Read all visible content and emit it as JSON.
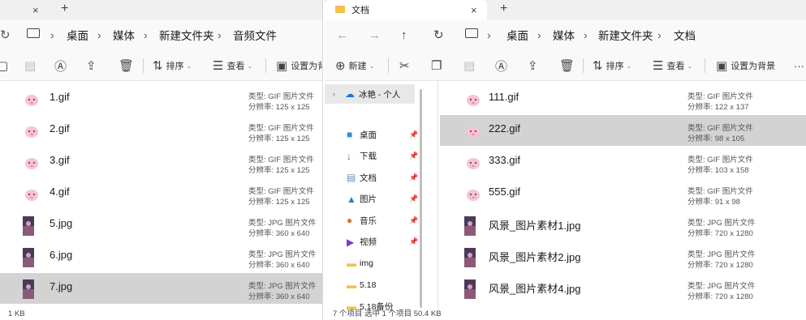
{
  "left_window": {
    "tab_close": "×",
    "new_tab": "+",
    "breadcrumb": [
      "桌面",
      "媒体",
      "新建文件夹",
      "音频文件"
    ],
    "toolbar": {
      "sort": "排序",
      "view": "查看",
      "set_bg": "设置为背"
    },
    "files": [
      {
        "name": "1.gif",
        "type": "类型: GIF 图片文件",
        "res": "分辨率: 125 x 125",
        "kind": "gif"
      },
      {
        "name": "2.gif",
        "type": "类型: GIF 图片文件",
        "res": "分辨率: 125 x 125",
        "kind": "gif"
      },
      {
        "name": "3.gif",
        "type": "类型: GIF 图片文件",
        "res": "分辨率: 125 x 125",
        "kind": "gif"
      },
      {
        "name": "4.gif",
        "type": "类型: GIF 图片文件",
        "res": "分辨率: 125 x 125",
        "kind": "gif"
      },
      {
        "name": "5.jpg",
        "type": "类型: JPG 图片文件",
        "res": "分辨率: 360 x 640",
        "kind": "jpg"
      },
      {
        "name": "6.jpg",
        "type": "类型: JPG 图片文件",
        "res": "分辨率: 360 x 640",
        "kind": "jpg"
      },
      {
        "name": "7.jpg",
        "type": "类型: JPG 图片文件",
        "res": "分辨率: 360 x 640",
        "kind": "jpg",
        "selected": true
      }
    ],
    "status": "1 KB"
  },
  "right_window": {
    "tab_title": "文档",
    "tab_close": "×",
    "new_tab": "+",
    "breadcrumb": [
      "桌面",
      "媒体",
      "新建文件夹",
      "文档"
    ],
    "toolbar": {
      "new": "新建",
      "sort": "排序",
      "view": "查看",
      "set_bg": "设置为背景",
      "more": "···"
    },
    "nav": [
      {
        "label": "冰艳 - 个人",
        "icon": "☁",
        "color": "#1a73e8",
        "pinned": false,
        "top": true
      },
      {
        "label": "桌面",
        "icon": "■",
        "color": "#2b8fd6",
        "pinned": true
      },
      {
        "label": "下载",
        "icon": "↓",
        "color": "#2a6fb5",
        "pinned": true
      },
      {
        "label": "文档",
        "icon": "▤",
        "color": "#6a8fb5",
        "pinned": true
      },
      {
        "label": "图片",
        "icon": "▲",
        "color": "#2f7bd0",
        "pinned": true
      },
      {
        "label": "音乐",
        "icon": "●",
        "color": "#e56a3a",
        "pinned": true
      },
      {
        "label": "视频",
        "icon": "▶",
        "color": "#7a3fc8",
        "pinned": true
      },
      {
        "label": "img",
        "icon": "▬",
        "color": "#f2c14e",
        "pinned": false
      },
      {
        "label": "5.18",
        "icon": "▬",
        "color": "#f2c14e",
        "pinned": false
      },
      {
        "label": "5.18备份",
        "icon": "▬",
        "color": "#f2c14e",
        "pinned": false
      }
    ],
    "files": [
      {
        "name": "111.gif",
        "type": "类型: GIF 图片文件",
        "res": "分辨率: 122 x 137",
        "kind": "gif"
      },
      {
        "name": "222.gif",
        "type": "类型: GIF 图片文件",
        "res": "分辨率: 98 x 105",
        "kind": "gif",
        "selected": true
      },
      {
        "name": "333.gif",
        "type": "类型: GIF 图片文件",
        "res": "分辨率: 103 x 158",
        "kind": "gif"
      },
      {
        "name": "555.gif",
        "type": "类型: GIF 图片文件",
        "res": "分辨率: 91 x 98",
        "kind": "gif"
      },
      {
        "name": "风景_图片素材1.jpg",
        "type": "类型: JPG 图片文件",
        "res": "分辨率: 720 x 1280",
        "kind": "jpg"
      },
      {
        "name": "风景_图片素材2.jpg",
        "type": "类型: JPG 图片文件",
        "res": "分辨率: 720 x 1280",
        "kind": "jpg"
      },
      {
        "name": "风景_图片素材4.jpg",
        "type": "类型: JPG 图片文件",
        "res": "分辨率: 720 x 1280",
        "kind": "jpg"
      }
    ],
    "status": "7 个项目    选中 1 个项目  50.4 KB"
  },
  "icons": {
    "back": "arrow-left-icon",
    "forward": "arrow-right-icon",
    "up": "arrow-up-icon",
    "refresh": "refresh-icon",
    "computer": "monitor-icon",
    "folder": "folder-icon"
  },
  "colors": {
    "selected_row": "#d3d3d3",
    "toolbar_bg": "#f9f9f9",
    "titlebar_bg": "#f0f0f0",
    "folder": "#f2c14e"
  }
}
